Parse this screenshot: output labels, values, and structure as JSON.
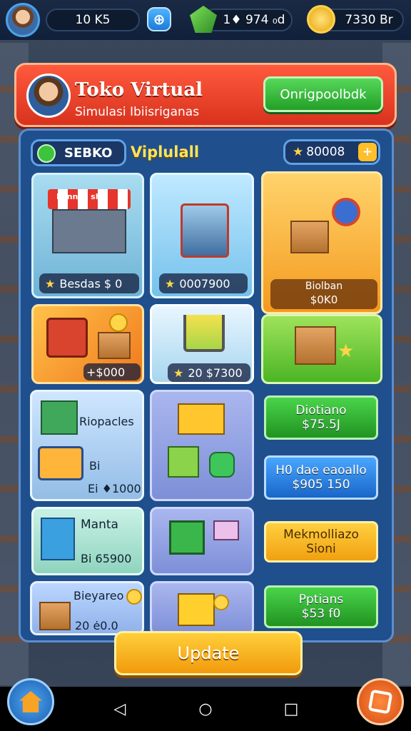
{
  "topbar": {
    "level_value": "10 K5",
    "gems_value": "1♦ 974 ₀d",
    "coins_value": "7330 Br"
  },
  "header": {
    "title": "Toko Virtual",
    "subtitle": "Simulasi Ibiisriganas",
    "button_label": "Onrigpoolbdk"
  },
  "panel": {
    "store_tag": "SEBKO",
    "store_name": "Viplulall",
    "balance": "80008"
  },
  "tiles": [
    {
      "sign": "Minnac shu",
      "price": "Besdas $ 0"
    },
    {
      "price": "0007900"
    },
    {
      "info_line1": "Biolban",
      "info_line2": "$0K0"
    },
    {
      "price": "+$000"
    },
    {
      "price": "20 $7300"
    },
    {},
    {
      "label": "Riopacles",
      "line2": "Bi",
      "price": "Ei ♦1000"
    },
    {},
    {
      "button_line1": "Diotiano",
      "button_line2": "$75.5J"
    },
    {
      "button_line1": "H0 dae eaoallo",
      "button_line2": "$905 150"
    },
    {
      "label": "Manta",
      "price": "Bi 65900"
    },
    {},
    {
      "button_line1": "Mekmolliazo",
      "button_line2": "Sioni"
    },
    {
      "label": "Bieyareo",
      "price": "20 ė0.0"
    },
    {},
    {
      "button_line1": "Pptians",
      "button_line2": "$53 f0"
    }
  ],
  "update_label": "Update",
  "colors": {
    "header_red": "#d8321e",
    "panel_blue": "#1f4f8c",
    "action_green": "#219322",
    "action_blue": "#1866c9",
    "action_yellow": "#f0a010"
  },
  "icons": {
    "home": "home-icon",
    "edit": "edit-icon",
    "back": "back-icon",
    "home_nav": "circle-icon",
    "recents": "square-icon"
  }
}
